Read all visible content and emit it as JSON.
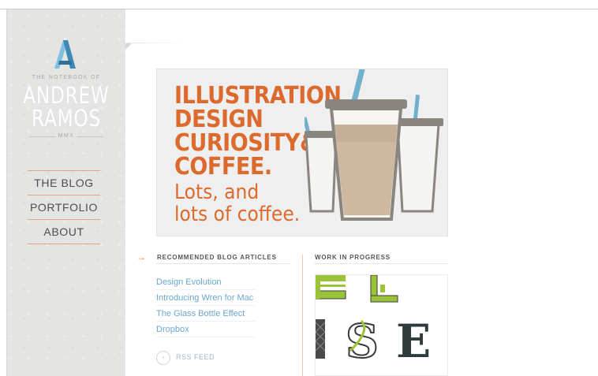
{
  "sidebar": {
    "logo_sub": "THE NOTEBOOK OF",
    "logo_name_line1": "ANDREW",
    "logo_name_line2": "RAMOS",
    "logo_mmx": "MMX",
    "nav": [
      {
        "label": "THE BLOG"
      },
      {
        "label": "PORTFOLIO"
      },
      {
        "label": "ABOUT"
      }
    ]
  },
  "hero": {
    "lines": [
      "ILLUSTRATION",
      "DESIGN",
      "CURIOSITY&",
      "COFFEE."
    ],
    "tagline1": "Lots, and",
    "tagline2": "lots of coffee."
  },
  "recommended": {
    "arrow": "→",
    "title": "RECOMMENDED BLOG ARTICLES",
    "articles": [
      {
        "label": "Design Evolution"
      },
      {
        "label": "Introducing Wren for Mac"
      },
      {
        "label": "The Glass Bottle Effect"
      },
      {
        "label": "Dropbox"
      }
    ],
    "rss_label": "RSS FEED"
  },
  "wip": {
    "title": "WORK IN PROGRESS",
    "letters": [
      "E",
      "E",
      "I",
      "S",
      "E"
    ]
  },
  "colors": {
    "accent": "#dc6a2c",
    "link": "#6aa7cf",
    "sidebar_bg": "#e4e4e2",
    "logo_blue": "#5aa0c8"
  },
  "icons": [
    "logo-a-icon",
    "rss-icon",
    "arrow-right-icon"
  ]
}
